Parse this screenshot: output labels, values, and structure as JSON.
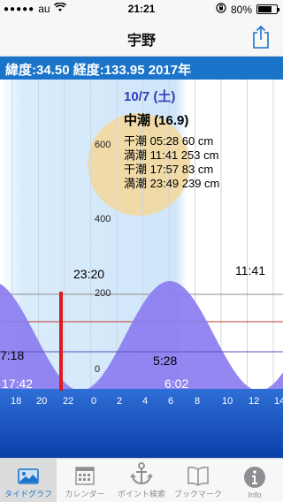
{
  "status_bar": {
    "carrier": "au",
    "time": "21:21",
    "battery": "80%",
    "battery_level": 0.8
  },
  "nav": {
    "title": "宇野",
    "share_icon": "share-icon"
  },
  "coords_text": "緯度:34.50 経度:133.95 2017年",
  "info": {
    "date": "10/7 (土)",
    "tide_name": "中潮 (16.9)",
    "rows": [
      "干潮 05:28  60 cm",
      "満潮 11:41 253 cm",
      "干潮 17:57  83 cm",
      "満潮 23:49 239 cm"
    ]
  },
  "chart_data": {
    "type": "area",
    "y_ticks": [
      "600",
      "400",
      "200",
      "0"
    ],
    "x_ticks": [
      "18",
      "20",
      "22",
      "0",
      "2",
      "4",
      "6",
      "8",
      "10",
      "12",
      "14"
    ],
    "points": [
      {
        "label": "23:20",
        "kind": "high"
      },
      {
        "label": "11:41",
        "kind": "high"
      },
      {
        "label": "7:18",
        "kind": "low"
      },
      {
        "label": "5:28",
        "kind": "low"
      }
    ],
    "bottom_labels": [
      "17:42",
      "6:02"
    ],
    "colors": {
      "tide_fill": "#8b7df0",
      "current_marker": "#e0191f",
      "daylight": "#cfe6fa",
      "moon": "#f1d9a2"
    }
  },
  "tabs": [
    {
      "label": "タイドグラフ",
      "icon": "photo-icon",
      "active": true
    },
    {
      "label": "カレンダー",
      "icon": "calendar-icon",
      "active": false
    },
    {
      "label": "ポイント検索",
      "icon": "anchor-icon",
      "active": false
    },
    {
      "label": "ブックマーク",
      "icon": "book-icon",
      "active": false
    },
    {
      "label": "Info",
      "icon": "info-icon",
      "active": false
    }
  ]
}
